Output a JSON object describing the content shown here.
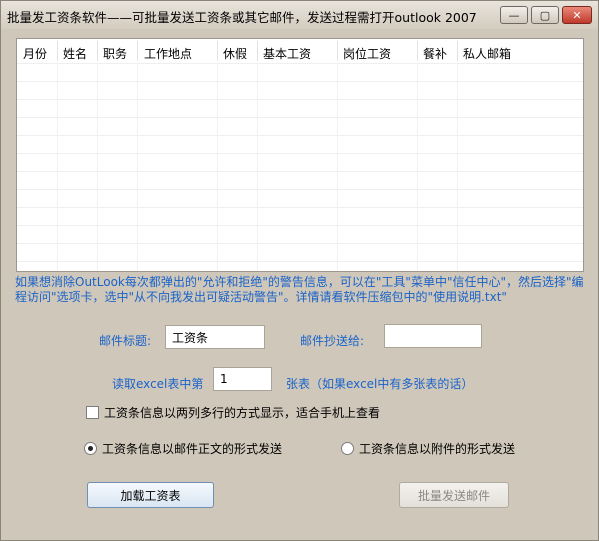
{
  "window": {
    "title": "批量发工资条软件——可批量发送工资条或其它邮件，发送过程需打开outlook 2007",
    "min_glyph": "—",
    "max_glyph": "▢",
    "close_glyph": "✕"
  },
  "grid": {
    "columns": [
      "月份",
      "姓名",
      "职务",
      "工作地点",
      "休假",
      "基本工资",
      "岗位工资",
      "餐补",
      "私人邮箱"
    ]
  },
  "info_text": "如果想消除OutLook每次都弹出的\"允许和拒绝\"的警告信息，可以在\"工具\"菜单中\"信任中心\"，然后选择\"编程访问\"选项卡，选中\"从不向我发出可疑活动警告\"。详情请看软件压缩包中的\"使用说明.txt\"",
  "form": {
    "subject_label": "邮件标题:",
    "subject_value": "工资条",
    "cc_label": "邮件抄送给:",
    "cc_value": "",
    "sheet_label_pre": "读取excel表中第",
    "sheet_value": "1",
    "sheet_label_post": "张表（如果excel中有多张表的话）",
    "two_column_label": "工资条信息以两列多行的方式显示，适合手机上查看",
    "radio_body_label": "工资条信息以邮件正文的形式发送",
    "radio_attach_label": "工资条信息以附件的形式发送"
  },
  "buttons": {
    "load": "加载工资表",
    "send": "批量发送邮件"
  }
}
